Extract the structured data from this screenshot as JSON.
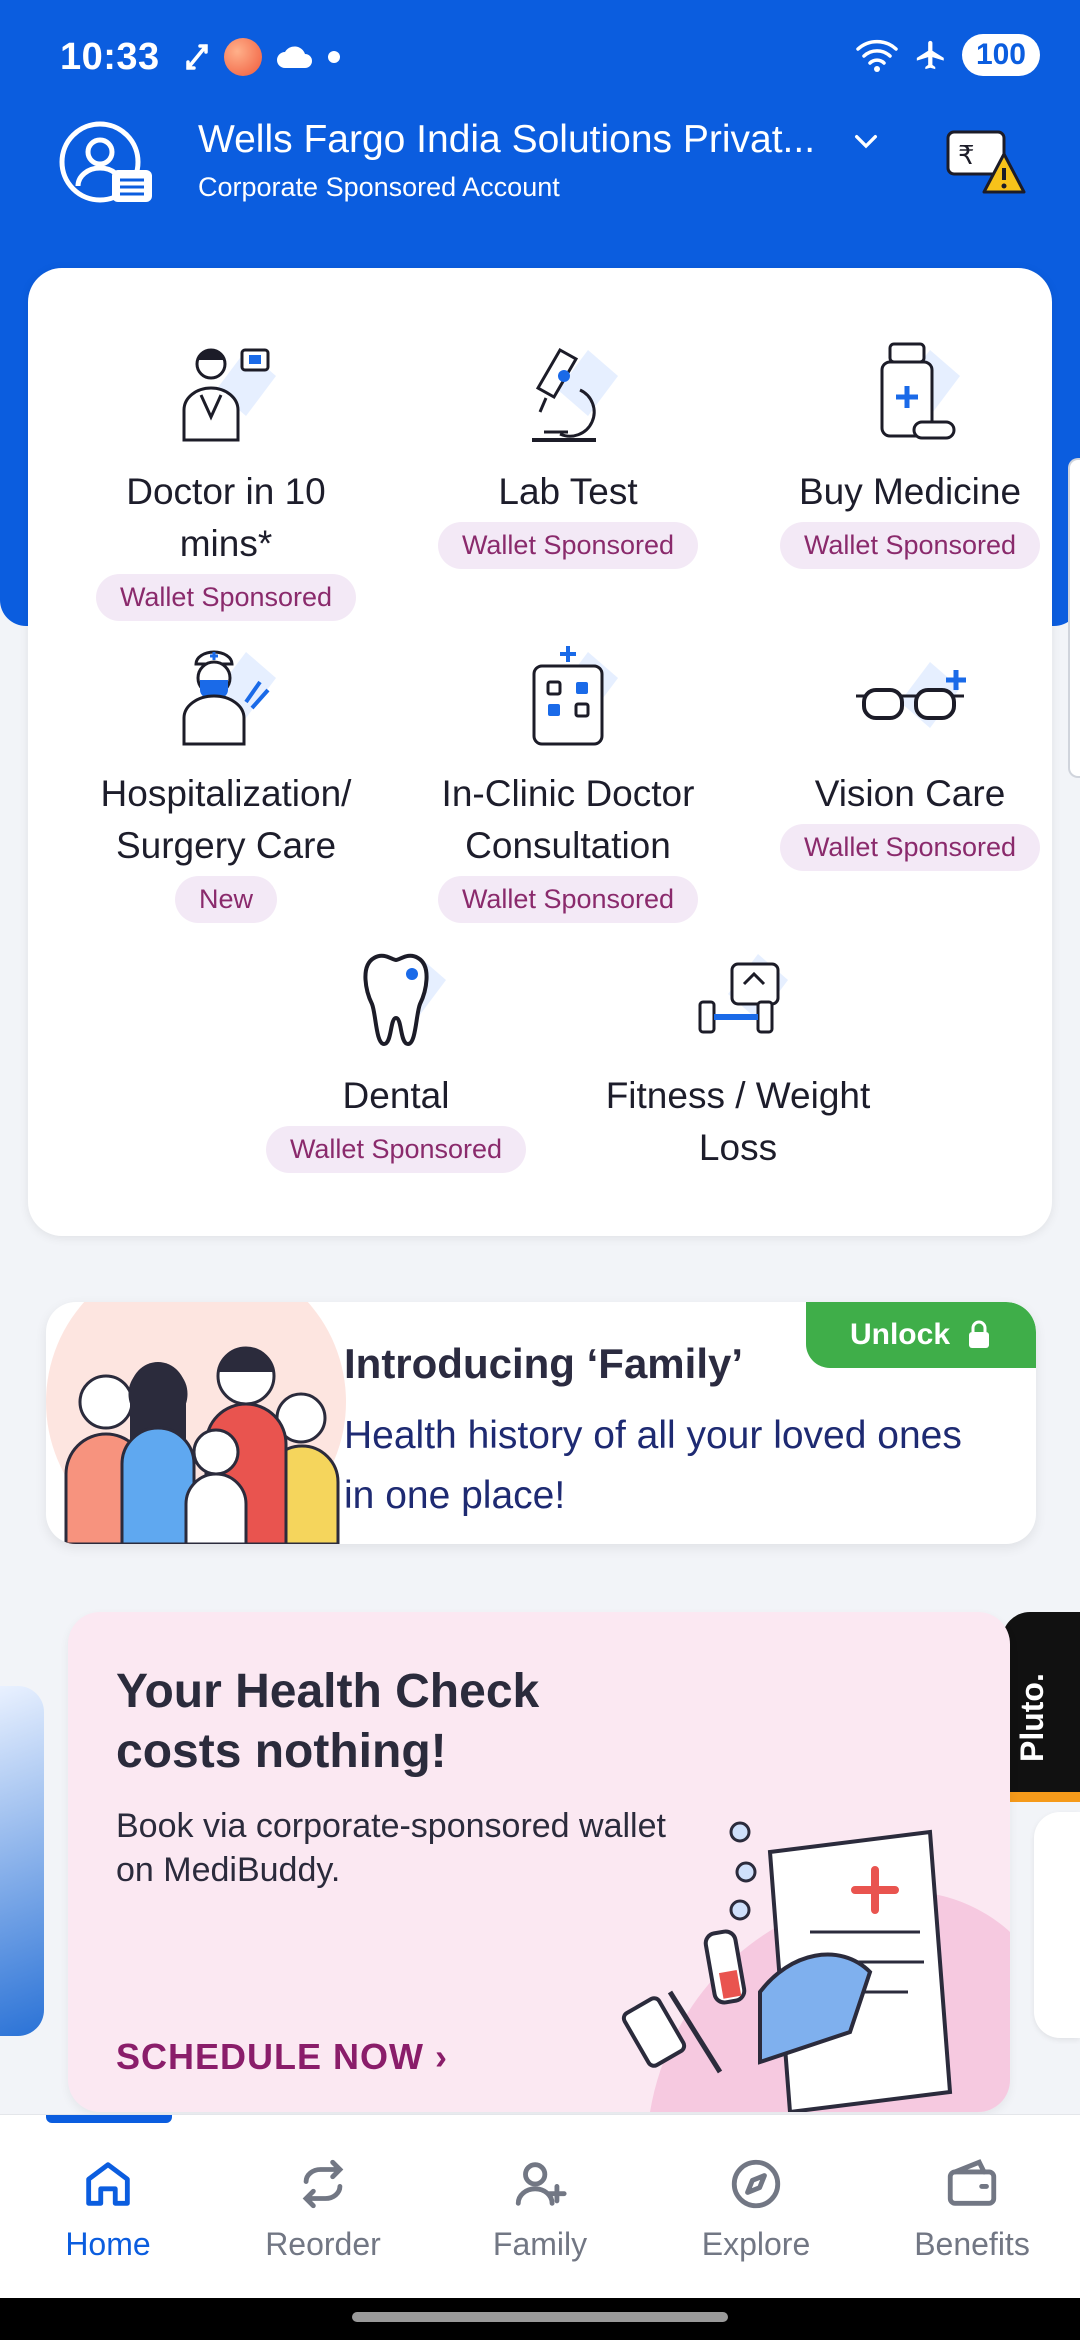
{
  "status_bar": {
    "time": "10:33",
    "battery": "100"
  },
  "header": {
    "company": "Wells Fargo India Solutions Privat...",
    "account_type": "Corporate Sponsored Account"
  },
  "services": [
    {
      "name_line1": "Doctor in 10",
      "name_line2": "mins*",
      "tag": "Wallet Sponsored"
    },
    {
      "name_line1": "Lab Test",
      "name_line2": "",
      "tag": "Wallet Sponsored"
    },
    {
      "name_line1": "Buy Medicine",
      "name_line2": "",
      "tag": "Wallet Sponsored"
    },
    {
      "name_line1": "Hospitalization/",
      "name_line2": "Surgery Care",
      "tag": "New"
    },
    {
      "name_line1": "In-Clinic Doctor",
      "name_line2": "Consultation",
      "tag": "Wallet Sponsored"
    },
    {
      "name_line1": "Vision Care",
      "name_line2": "",
      "tag": "Wallet Sponsored"
    },
    {
      "name_line1": "Dental",
      "name_line2": "",
      "tag": "Wallet Sponsored"
    },
    {
      "name_line1": "Fitness / Weight",
      "name_line2": "Loss",
      "tag": ""
    }
  ],
  "family_banner": {
    "title": "Introducing ‘Family’",
    "description": "Health history of all your loved ones in one place!",
    "unlock_label": "Unlock"
  },
  "health_check": {
    "title": "Your Health Check costs nothing!",
    "subtitle": "Book via corporate-sponsored wallet on MediBuddy.",
    "cta": "SCHEDULE NOW ›"
  },
  "side_card_right": {
    "label": "Pluto."
  },
  "bottom_nav": [
    {
      "label": "Home",
      "icon": "home-icon",
      "active": true
    },
    {
      "label": "Reorder",
      "icon": "reorder-icon",
      "active": false
    },
    {
      "label": "Family",
      "icon": "add-person-icon",
      "active": false
    },
    {
      "label": "Explore",
      "icon": "compass-icon",
      "active": false
    },
    {
      "label": "Benefits",
      "icon": "wallet-icon",
      "active": false
    }
  ],
  "colors": {
    "brand_blue": "#0b5ddf",
    "tag_bg": "#f3e9f6",
    "tag_text": "#8a2a6c",
    "unlock_green": "#3fae49",
    "cta_magenta": "#8a1d6a"
  }
}
